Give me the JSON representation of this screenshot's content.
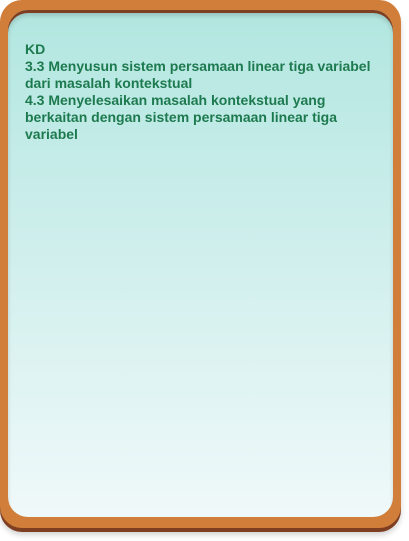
{
  "card": {
    "heading": "KD",
    "lines": [
      "3.3 Menyusun sistem persamaan linear tiga variabel dari masalah kontekstual",
      "4.3 Menyelesaikan masalah kontekstual yang berkaitan dengan sistem persamaan linear tiga variabel"
    ]
  },
  "colors": {
    "frame": "#D07E3A",
    "text": "#1D7A4F",
    "panel": "#B2E6E0"
  }
}
